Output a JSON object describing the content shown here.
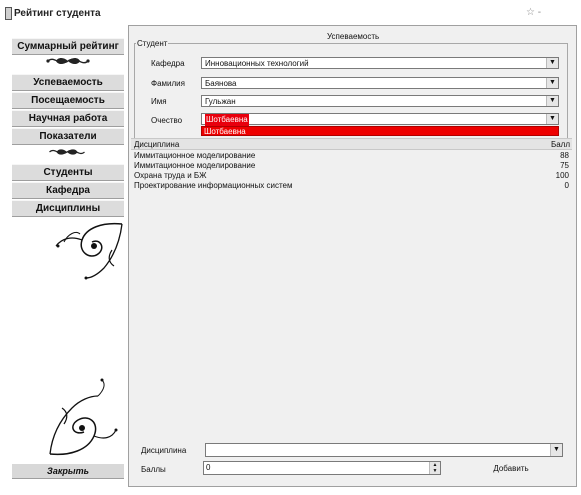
{
  "window": {
    "title": "Рейтинг студента",
    "controls_glyph": "☆ -"
  },
  "sidebar": {
    "items": [
      {
        "label": "Суммарный рейтинг"
      },
      {
        "label": "Успеваемость"
      },
      {
        "label": "Посещаемость"
      },
      {
        "label": "Научная работа"
      },
      {
        "label": "Показатели"
      },
      {
        "label": "Студенты"
      },
      {
        "label": "Кафедра"
      },
      {
        "label": "Дисциплины"
      }
    ],
    "close_label": "Закрыть"
  },
  "main": {
    "title": "Успеваемость",
    "student_group": {
      "legend": "Студент",
      "fields": [
        {
          "label": "Кафедра",
          "value": "Инновационных технологий"
        },
        {
          "label": "Фамилия",
          "value": "Баянова"
        },
        {
          "label": "Имя",
          "value": "Гульжан"
        },
        {
          "label": "Очество",
          "value": "Шотбаевна"
        }
      ],
      "dropdown_option": "Шотбаевна"
    },
    "table": {
      "columns": [
        "Дисциплина",
        "Балл"
      ],
      "rows": [
        {
          "discipline": "Иммитационное моделирование",
          "score": "88"
        },
        {
          "discipline": "Иммитационное моделирование",
          "score": "75"
        },
        {
          "discipline": "Охрана труда и БЖ",
          "score": "100"
        },
        {
          "discipline": "Проектирование информационных систем",
          "score": "0"
        }
      ]
    },
    "bottom": {
      "discipline_label": "Дисциплина",
      "discipline_value": "",
      "score_label": "Баллы",
      "score_value": "0",
      "add_label": "Добавить"
    }
  },
  "colors": {
    "highlight": "#ee0000",
    "panel_bg": "#f0f0f0",
    "button_bg": "#dcdcdc"
  },
  "icons": [
    "app-icon",
    "ornament-icon",
    "corner-flourish-icon",
    "chevron-down-icon",
    "spin-up-icon",
    "spin-down-icon"
  ]
}
